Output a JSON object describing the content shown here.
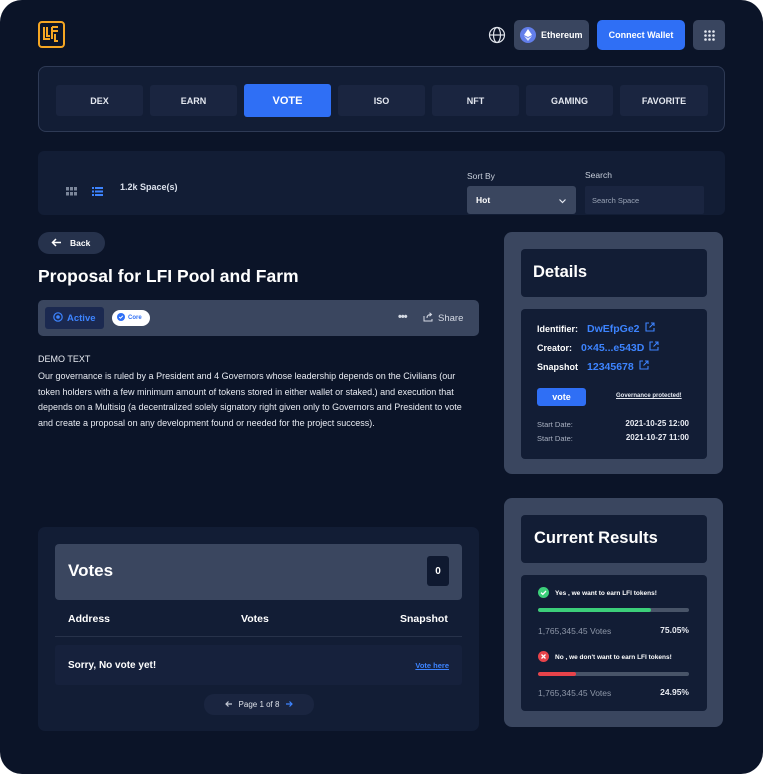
{
  "header": {
    "network_label": "Ethereum",
    "connect_label": "Connect Wallet",
    "logo_icon": "lfi-logo-icon",
    "globe_icon": "globe-icon",
    "apps_icon": "apps-grid-icon"
  },
  "nav": {
    "tabs": [
      "DEX",
      "EARN",
      "VOTE",
      "ISO",
      "NFT",
      "GAMING",
      "FAVORITE"
    ],
    "active_tab": "VOTE"
  },
  "filter": {
    "spaces_count": "1.2k Space(s)",
    "sort_label": "Sort By",
    "sort_value": "Hot",
    "search_label": "Search",
    "search_placeholder": "Search Space"
  },
  "proposal": {
    "back_label": "Back",
    "title": "Proposal for LFI Pool and Farm",
    "status": "Active",
    "badge": "Core",
    "share_label": "Share",
    "demo_heading": "DEMO TEXT",
    "body": "Our governance is ruled by a President and 4 Governors whose leadership depends on the Civilians (our token holders with a few minimum amount of tokens stored in either wallet or staked.) and execution that depends on a Multisig (a decentralized solely signatory right given only to Governors and President to vote and create a proposal on any development found or needed for the project success)."
  },
  "details": {
    "title": "Details",
    "identifier_label": "Identifier:",
    "identifier_value": "DwEfpGe2",
    "creator_label": "Creator:",
    "creator_value": "0×45...e543D",
    "snapshot_label": "Snapshot",
    "snapshot_value": "12345678",
    "vote_label": "vote",
    "governance_link": "Governance protected!",
    "start_label": "Start Date:",
    "start_value": "2021-10-25 12:00",
    "end_label": "Start Date:",
    "end_value": "2021-10-27 11:00"
  },
  "results": {
    "title": "Current Results",
    "options": [
      {
        "label": "Yes , we want to earn LFI tokens!",
        "votes": "1,765,345.45 Votes",
        "percent": "75.05%",
        "fraction": 0.7505,
        "color": "#3ccf7a"
      },
      {
        "label": "No , we don't want to earn LFI tokens!",
        "votes": "1,765,345.45 Votes",
        "percent": "24.95%",
        "fraction": 0.2495,
        "color": "#e8434a"
      }
    ]
  },
  "votes": {
    "title": "Votes",
    "count": "0",
    "col_address": "Address",
    "col_votes": "Votes",
    "col_snapshot": "Snapshot",
    "empty": "Sorry, No vote yet!",
    "vote_here": "Vote here",
    "page_label": "Page 1 of  8"
  }
}
